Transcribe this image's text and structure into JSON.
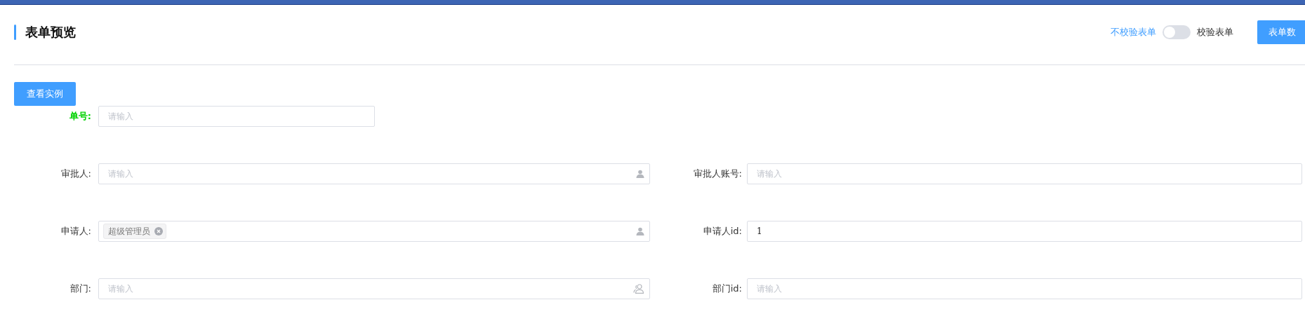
{
  "header": {
    "title": "表单预览",
    "validate_toggle": {
      "off_label": "不校验表单",
      "on_label": "校验表单",
      "on": false
    },
    "data_button": "表单数"
  },
  "example_button": "查看实例",
  "rows": [
    {
      "fields": [
        {
          "label": "单号:",
          "kind": "text",
          "highlighted": true,
          "placeholder": "请输入"
        }
      ]
    },
    {
      "fields": [
        {
          "label": "审批人:",
          "kind": "user",
          "highlighted": false,
          "placeholder": "请输入"
        },
        {
          "label": "审批人账号:",
          "kind": "text",
          "highlighted": false,
          "placeholder": "请输入"
        }
      ]
    },
    {
      "fields": [
        {
          "label": "申请人:",
          "kind": "user",
          "highlighted": false,
          "tags": [
            "超级管理员"
          ]
        },
        {
          "label": "申请人id:",
          "kind": "text",
          "highlighted": false,
          "value": "1"
        }
      ]
    },
    {
      "fields": [
        {
          "label": "部门:",
          "kind": "dept",
          "highlighted": false,
          "placeholder": "请输入"
        },
        {
          "label": "部门id:",
          "kind": "text",
          "highlighted": false,
          "placeholder": "请输入"
        }
      ]
    }
  ]
}
